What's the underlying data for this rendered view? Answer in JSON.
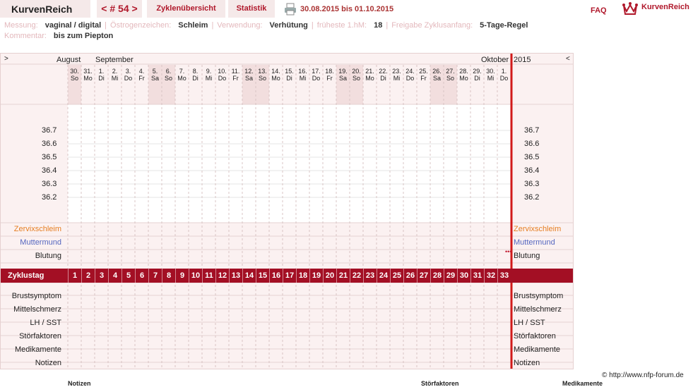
{
  "app_title": "KurvenReich",
  "cycle_nav": "< # 54 >",
  "tabs": [
    {
      "label": "Zyklenübersicht"
    },
    {
      "label": "Statistik"
    }
  ],
  "date_range": "30.08.2015 bis 01.10.2015",
  "faq": "FAQ",
  "logo_text": "KurvenReich",
  "meta": {
    "messung_label": "Messung:",
    "messung": "vaginal / digital",
    "oestrogen_label": "Östrogenzeichen:",
    "oestrogen": "Schleim",
    "verwendung_label": "Verwendung:",
    "verwendung": "Verhütung",
    "frueheste_label": "früheste 1.hM:",
    "frueheste": "18",
    "freigabe_label": "Freigabe Zyklusanfang:",
    "freigabe": "5-Tage-Regel",
    "kommentar_label": "Kommentar:",
    "kommentar": "bis zum Piepton"
  },
  "chart": {
    "nav_prev": ">",
    "nav_next": "<",
    "months": [
      {
        "label": "August",
        "day_index": 0
      },
      {
        "label": "September",
        "day_index": 1
      },
      {
        "label": "Oktober",
        "day_index": 31
      }
    ],
    "year": "2015",
    "days": [
      {
        "date": "30.",
        "dow": "So",
        "weekend": true
      },
      {
        "date": "31.",
        "dow": "Mo",
        "weekend": false
      },
      {
        "date": "1.",
        "dow": "Di",
        "weekend": false
      },
      {
        "date": "2.",
        "dow": "Mi",
        "weekend": false
      },
      {
        "date": "3.",
        "dow": "Do",
        "weekend": false
      },
      {
        "date": "4.",
        "dow": "Fr",
        "weekend": false
      },
      {
        "date": "5.",
        "dow": "Sa",
        "weekend": true
      },
      {
        "date": "6.",
        "dow": "So",
        "weekend": true
      },
      {
        "date": "7.",
        "dow": "Mo",
        "weekend": false
      },
      {
        "date": "8.",
        "dow": "Di",
        "weekend": false
      },
      {
        "date": "9.",
        "dow": "Mi",
        "weekend": false
      },
      {
        "date": "10.",
        "dow": "Do",
        "weekend": false
      },
      {
        "date": "11.",
        "dow": "Fr",
        "weekend": false
      },
      {
        "date": "12.",
        "dow": "Sa",
        "weekend": true
      },
      {
        "date": "13.",
        "dow": "So",
        "weekend": true
      },
      {
        "date": "14.",
        "dow": "Mo",
        "weekend": false
      },
      {
        "date": "15.",
        "dow": "Di",
        "weekend": false
      },
      {
        "date": "16.",
        "dow": "Mi",
        "weekend": false
      },
      {
        "date": "17.",
        "dow": "Do",
        "weekend": false
      },
      {
        "date": "18.",
        "dow": "Fr",
        "weekend": false
      },
      {
        "date": "19.",
        "dow": "Sa",
        "weekend": true
      },
      {
        "date": "20.",
        "dow": "So",
        "weekend": true
      },
      {
        "date": "21.",
        "dow": "Mo",
        "weekend": false
      },
      {
        "date": "22.",
        "dow": "Di",
        "weekend": false
      },
      {
        "date": "23.",
        "dow": "Mi",
        "weekend": false
      },
      {
        "date": "24.",
        "dow": "Do",
        "weekend": false
      },
      {
        "date": "25.",
        "dow": "Fr",
        "weekend": false
      },
      {
        "date": "26.",
        "dow": "Sa",
        "weekend": true
      },
      {
        "date": "27.",
        "dow": "So",
        "weekend": true
      },
      {
        "date": "28.",
        "dow": "Mo",
        "weekend": false
      },
      {
        "date": "29.",
        "dow": "Di",
        "weekend": false
      },
      {
        "date": "30.",
        "dow": "Mi",
        "weekend": false
      },
      {
        "date": "1.",
        "dow": "Do",
        "weekend": false
      }
    ],
    "temps": [
      "36.7",
      "36.6",
      "36.5",
      "36.4",
      "36.3",
      "36.2"
    ],
    "rows_mid": [
      {
        "label": "Zervixschleim",
        "color": "#e67e22"
      },
      {
        "label": "Muttermund",
        "color": "#5567c0"
      },
      {
        "label": "Blutung",
        "color": "#222222"
      }
    ],
    "blutung_marker": "•••",
    "zyklustag_label": "Zyklustag",
    "zyklustage": [
      "1",
      "2",
      "3",
      "4",
      "5",
      "6",
      "7",
      "8",
      "9",
      "10",
      "11",
      "12",
      "13",
      "14",
      "15",
      "16",
      "17",
      "18",
      "19",
      "20",
      "21",
      "22",
      "23",
      "24",
      "25",
      "26",
      "27",
      "28",
      "29",
      "30",
      "31",
      "32",
      "33"
    ],
    "rows_bottom": [
      "Brustsymptom",
      "Mittelschmerz",
      "LH / SST",
      "Störfaktoren",
      "Medikamente",
      "Notizen"
    ],
    "colors": {
      "accent": "#a30f24",
      "today_line": "#d11a1a",
      "weekend": "#f2dede"
    }
  },
  "copyright": "© http://www.nfp-forum.de",
  "footer_cut": [
    "Notizen",
    "Störfaktoren",
    "Medikamente"
  ]
}
